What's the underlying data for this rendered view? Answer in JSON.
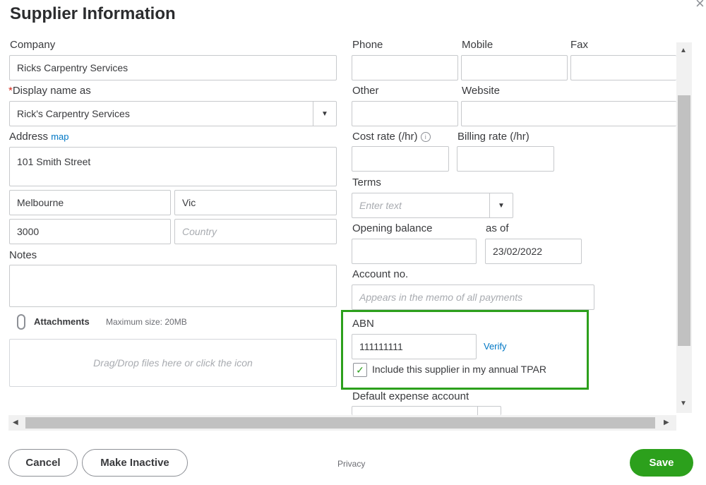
{
  "dialog": {
    "title": "Supplier Information",
    "close_glyph": "×"
  },
  "left": {
    "company_label": "Company",
    "company_value": "Ricks Carpentry Services",
    "required_mark": "*",
    "display_name_label": "Display name as",
    "display_name_value": "Rick's Carpentry Services",
    "address_label": "Address",
    "map_link": "map",
    "street_value": "101 Smith Street",
    "city_value": "Melbourne",
    "state_value": "Vic",
    "postcode_value": "3000",
    "country_placeholder": "Country",
    "notes_label": "Notes",
    "attachments_label": "Attachments",
    "max_size_text": "Maximum size: 20MB",
    "dropzone_text": "Drag/Drop files here or click the icon"
  },
  "right": {
    "phone_label": "Phone",
    "mobile_label": "Mobile",
    "fax_label": "Fax",
    "other_label": "Other",
    "website_label": "Website",
    "cost_rate_label": "Cost rate (/hr)",
    "billing_rate_label": "Billing rate (/hr)",
    "terms_label": "Terms",
    "terms_placeholder": "Enter text",
    "opening_balance_label": "Opening balance",
    "as_of_label": "as of",
    "as_of_value": "23/02/2022",
    "account_no_label": "Account no.",
    "account_no_placeholder": "Appears in the memo of all payments",
    "abn_label": "ABN",
    "abn_value": "111111111",
    "verify_link": "Verify",
    "tpar_checkbox_label": "Include this supplier in my annual TPAR",
    "tpar_checked": true,
    "default_expense_label": "Default expense account"
  },
  "footer": {
    "cancel_label": "Cancel",
    "make_inactive_label": "Make Inactive",
    "privacy_label": "Privacy",
    "save_label": "Save"
  },
  "colors": {
    "accent_green": "#2ca01c",
    "link_blue": "#0077c5",
    "required_red": "#d52b1e"
  },
  "icons": [
    "close-icon",
    "info-icon",
    "paperclip-icon",
    "chevron-down-icon",
    "checkmark-icon",
    "scroll-up-icon",
    "scroll-down-icon",
    "scroll-left-icon",
    "scroll-right-icon"
  ]
}
